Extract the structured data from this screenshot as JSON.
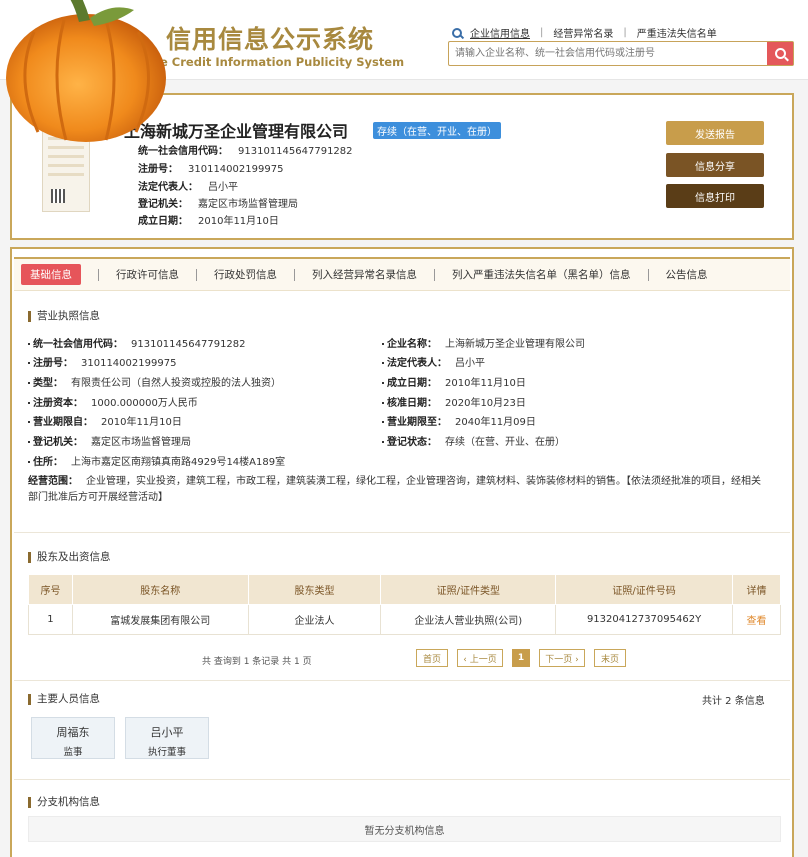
{
  "header": {
    "title": "信用信息公示系统",
    "subtitle": "e Credit Information Publicity System",
    "links": [
      "企业信用信息",
      "经营异常名录",
      "严重违法失信名单"
    ],
    "search_placeholder": "请输入企业名称、统一社会信用代码或注册号"
  },
  "company": {
    "name": "上海新城万圣企业管理有限公司",
    "status": "存续（在营、开业、在册）",
    "fields": [
      {
        "label": "统一社会信用代码：",
        "value": "913101145647791282"
      },
      {
        "label": "注册号：",
        "value": "310114002199975"
      },
      {
        "label": "法定代表人：",
        "value": "吕小平"
      },
      {
        "label": "登记机关：",
        "value": "嘉定区市场监督管理局"
      },
      {
        "label": "成立日期：",
        "value": "2010年11月10日"
      }
    ],
    "buttons": {
      "report": "发送报告",
      "share": "信息分享",
      "print": "信息打印"
    }
  },
  "tabs": [
    "基础信息",
    "行政许可信息",
    "行政处罚信息",
    "列入经营异常名录信息",
    "列入严重违法失信名单（黑名单）信息",
    "公告信息"
  ],
  "license": {
    "section_title": "营业执照信息",
    "left": [
      {
        "label": "统一社会信用代码：",
        "value": "913101145647791282"
      },
      {
        "label": "注册号：",
        "value": "310114002199975"
      },
      {
        "label": "类型：",
        "value": "有限责任公司（自然人投资或控股的法人独资）"
      },
      {
        "label": "注册资本：",
        "value": "1000.000000万人民币"
      },
      {
        "label": "营业期限自：",
        "value": "2010年11月10日"
      },
      {
        "label": "登记机关：",
        "value": "嘉定区市场监督管理局"
      },
      {
        "label": "住所：",
        "value": "上海市嘉定区南翔镇真南路4929号14楼A189室"
      }
    ],
    "right": [
      {
        "label": "企业名称：",
        "value": "上海新城万圣企业管理有限公司"
      },
      {
        "label": "法定代表人：",
        "value": "吕小平"
      },
      {
        "label": "成立日期：",
        "value": "2010年11月10日"
      },
      {
        "label": "核准日期：",
        "value": "2020年10月23日"
      },
      {
        "label": "营业期限至：",
        "value": "2040年11月09日"
      },
      {
        "label": "登记状态：",
        "value": "存续（在营、开业、在册）"
      }
    ],
    "scope_label": "经营范围：",
    "scope_value": "企业管理，实业投资，建筑工程，市政工程，建筑装潢工程，绿化工程，企业管理咨询，建筑材料、装饰装修材料的销售。【依法须经批准的项目，经相关部门批准后方可开展经营活动】"
  },
  "shareholders": {
    "section_title": "股东及出资信息",
    "headers": [
      "序号",
      "股东名称",
      "股东类型",
      "证照/证件类型",
      "证照/证件号码",
      "详情"
    ],
    "rows": [
      [
        "1",
        "富城发展集团有限公司",
        "企业法人",
        "企业法人营业执照(公司)",
        "91320412737095462Y",
        "查看"
      ]
    ],
    "pager_info": "共 查询到 1 条记录 共 1 页",
    "pager": [
      "首页",
      "‹ 上一页",
      "1",
      "下一页 ›",
      "末页"
    ]
  },
  "personnel": {
    "section_title": "主要人员信息",
    "total": "共计 2 条信息",
    "people": [
      {
        "name": "周福东",
        "role": "监事"
      },
      {
        "name": "吕小平",
        "role": "执行董事"
      }
    ]
  },
  "branches": {
    "section_title": "分支机构信息",
    "empty": "暂无分支机构信息"
  }
}
